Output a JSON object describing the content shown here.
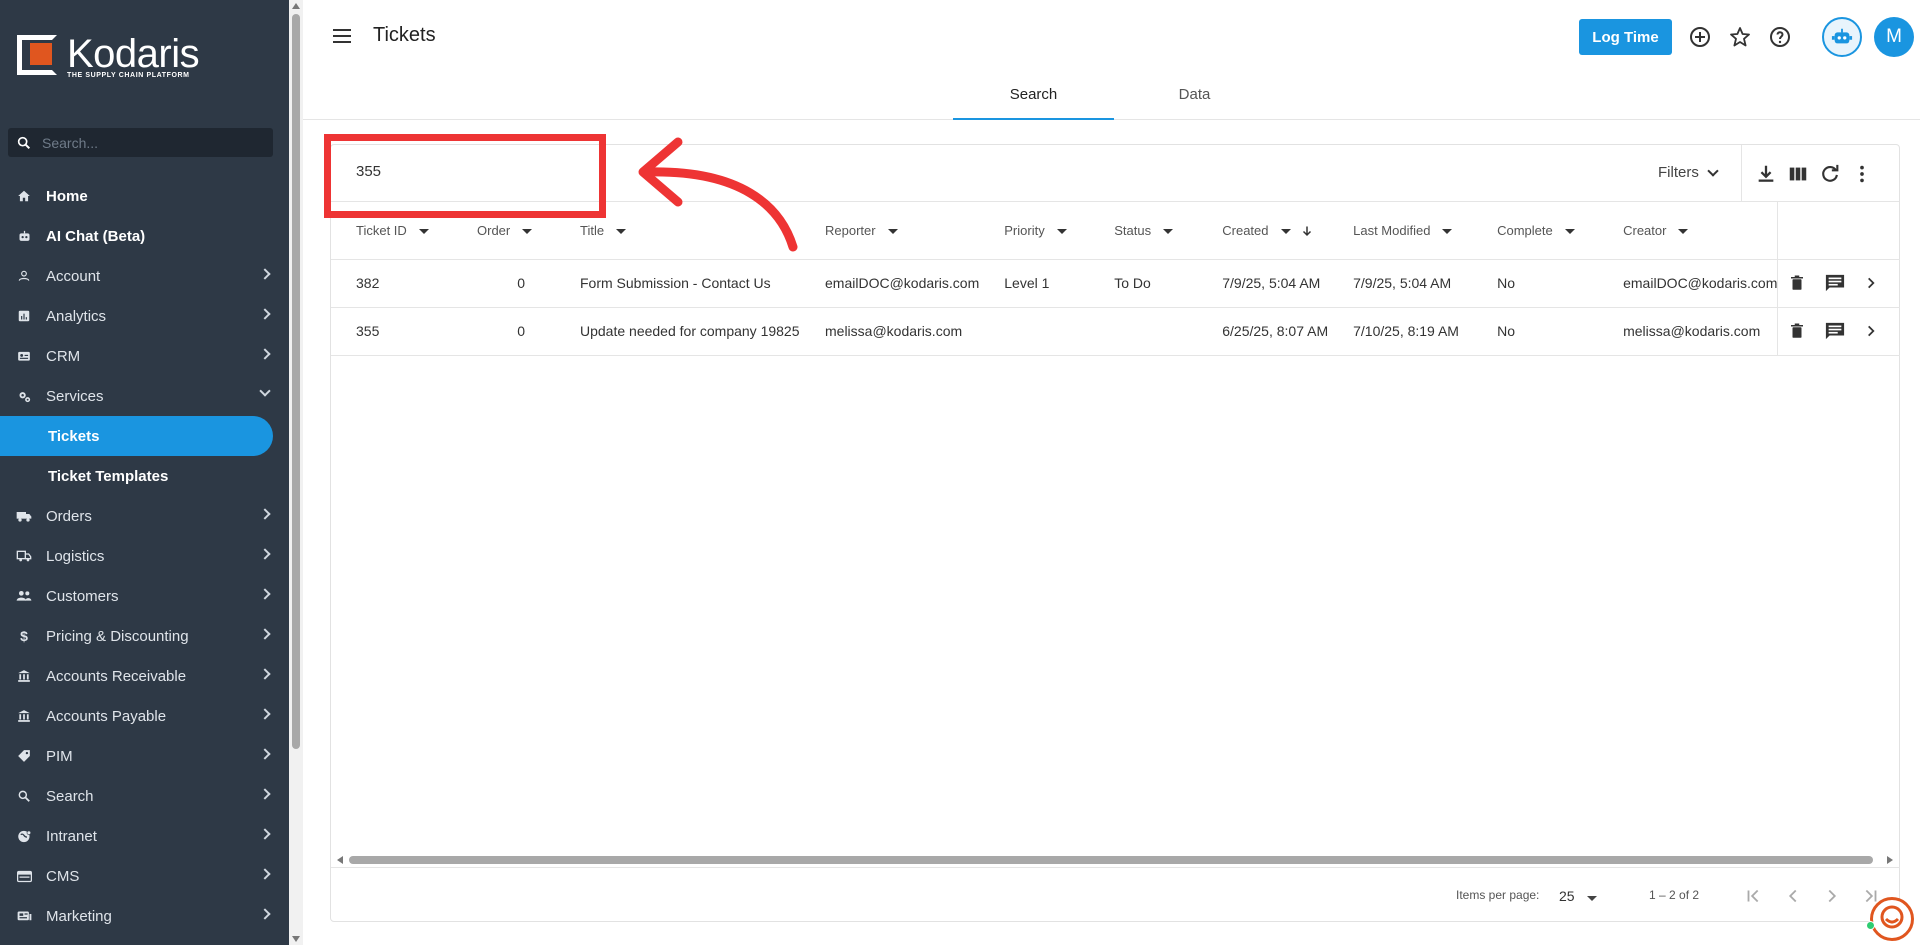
{
  "logo": {
    "name": "Kodaris",
    "tagline": "THE SUPPLY CHAIN PLATFORM"
  },
  "sidebar": {
    "search_placeholder": "Search...",
    "items": [
      {
        "label": "Home",
        "icon": "home-icon"
      },
      {
        "label": "AI Chat (Beta)",
        "icon": "robot-icon"
      },
      {
        "label": "Account",
        "icon": "person-icon"
      },
      {
        "label": "Analytics",
        "icon": "analytics-icon"
      },
      {
        "label": "CRM",
        "icon": "crm-icon"
      },
      {
        "label": "Services",
        "icon": "services-icon"
      },
      {
        "label": "Tickets"
      },
      {
        "label": "Ticket Templates"
      },
      {
        "label": "Orders",
        "icon": "truck-icon"
      },
      {
        "label": "Logistics",
        "icon": "logistics-icon"
      },
      {
        "label": "Customers",
        "icon": "people-icon"
      },
      {
        "label": "Pricing & Discounting",
        "icon": "dollar-icon"
      },
      {
        "label": "Accounts Receivable",
        "icon": "bank-icon"
      },
      {
        "label": "Accounts Payable",
        "icon": "bank-icon"
      },
      {
        "label": "PIM",
        "icon": "tag-icon"
      },
      {
        "label": "Search",
        "icon": "search-icon"
      },
      {
        "label": "Intranet",
        "icon": "globe-icon"
      },
      {
        "label": "CMS",
        "icon": "cms-icon"
      },
      {
        "label": "Marketing",
        "icon": "marketing-icon"
      }
    ]
  },
  "header": {
    "title": "Tickets",
    "log_time_label": "Log Time",
    "avatar_initial": "M",
    "tabs": [
      {
        "label": "Search"
      },
      {
        "label": "Data"
      }
    ]
  },
  "search": {
    "value": "355",
    "filters_label": "Filters"
  },
  "table": {
    "columns": [
      "Ticket ID",
      "Order",
      "Title",
      "Reporter",
      "Priority",
      "Status",
      "Created",
      "Last Modified",
      "Complete",
      "Creator"
    ],
    "rows": [
      {
        "ticket_id": "382",
        "order": "0",
        "title": "Form Submission - Contact Us",
        "reporter": "emailDOC@kodaris.com",
        "priority": "Level 1",
        "status": "To Do",
        "created": "7/9/25, 5:04 AM",
        "last_modified": "7/9/25, 5:04 AM",
        "complete": "No",
        "creator": "emailDOC@kodaris.com"
      },
      {
        "ticket_id": "355",
        "order": "0",
        "title": "Update needed for company 19825",
        "reporter": "melissa@kodaris.com",
        "priority": "",
        "status": "",
        "created": "6/25/25, 8:07 AM",
        "last_modified": "7/10/25, 8:19 AM",
        "complete": "No",
        "creator": "melissa@kodaris.com"
      }
    ]
  },
  "paginator": {
    "items_per_page_label": "Items per page:",
    "items_per_page": "25",
    "range": "1 – 2 of 2"
  },
  "colors": {
    "accent": "#1a95e0",
    "sidebar": "#2e3946",
    "annotation": "#ee3434",
    "brand": "#e0561f"
  }
}
